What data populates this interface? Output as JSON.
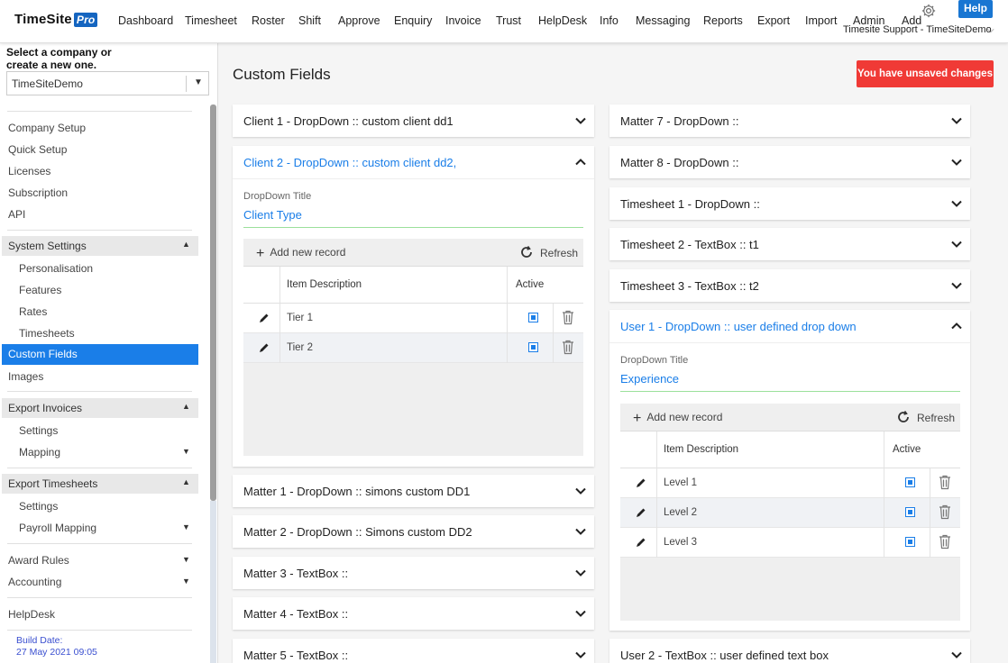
{
  "app": {
    "brand": "TimeSite",
    "brand_badge": "Pro"
  },
  "nav": [
    "Dashboard",
    "Timesheet",
    "Roster",
    "Shift",
    "Approve",
    "Enquiry",
    "Invoice",
    "Trust",
    "HelpDesk",
    "Info",
    "Messaging",
    "Reports",
    "Export",
    "Import",
    "Admin",
    "Add"
  ],
  "header": {
    "help_label": "Help",
    "user": "Timesite Support - TimeSiteDemo"
  },
  "sidebar": {
    "prompt": "Select a company or create a new one.",
    "company": "TimeSiteDemo",
    "items": [
      "Company Setup",
      "Quick Setup",
      "Licenses",
      "Subscription",
      "API"
    ],
    "system_settings": {
      "label": "System Settings",
      "items": [
        "Personalisation",
        "Features",
        "Rates",
        "Timesheets"
      ]
    },
    "active": "Custom Fields",
    "images": "Images",
    "export_invoices": {
      "label": "Export Invoices",
      "items": [
        "Settings",
        "Mapping"
      ]
    },
    "export_timesheets": {
      "label": "Export Timesheets",
      "items": [
        "Settings",
        "Payroll Mapping"
      ]
    },
    "award_rules": "Award Rules",
    "accounting": "Accounting",
    "helpdesk": "HelpDesk",
    "build_label": "Build Date:",
    "build_date": "27 May 2021 09:05"
  },
  "main": {
    "title": "Custom Fields",
    "unsaved": "You have unsaved changes",
    "left_panels": [
      "Client 1 - DropDown :: custom client dd1",
      "Client 2 - DropDown :: custom client dd2,",
      "Matter 1 - DropDown :: simons custom DD1",
      "Matter 2 - DropDown :: Simons custom DD2",
      "Matter 3 - TextBox ::",
      "Matter 4 - TextBox ::",
      "Matter 5 - TextBox ::"
    ],
    "right_panels": [
      "Matter 7 - DropDown ::",
      "Matter 8 - DropDown ::",
      "Timesheet 1 - DropDown ::",
      "Timesheet 2 - TextBox :: t1",
      "Timesheet 3 - TextBox :: t2",
      "User 1 - DropDown :: user defined drop down",
      "User 2 - TextBox :: user defined text box"
    ],
    "client2": {
      "dd_title_label": "DropDown Title",
      "dd_title_value": "Client Type",
      "add_label": "Add new record",
      "refresh_label": "Refresh",
      "col_desc": "Item Description",
      "col_active": "Active",
      "rows": [
        "Tier 1",
        "Tier 2"
      ]
    },
    "user1": {
      "dd_title_label": "DropDown Title",
      "dd_title_value": "Experience",
      "add_label": "Add new record",
      "refresh_label": "Refresh",
      "col_desc": "Item Description",
      "col_active": "Active",
      "rows": [
        "Level 1",
        "Level 2",
        "Level 3"
      ]
    }
  },
  "colors": {
    "accent": "#1a7ee8",
    "alert": "#f03a36",
    "help": "#1976d2"
  }
}
